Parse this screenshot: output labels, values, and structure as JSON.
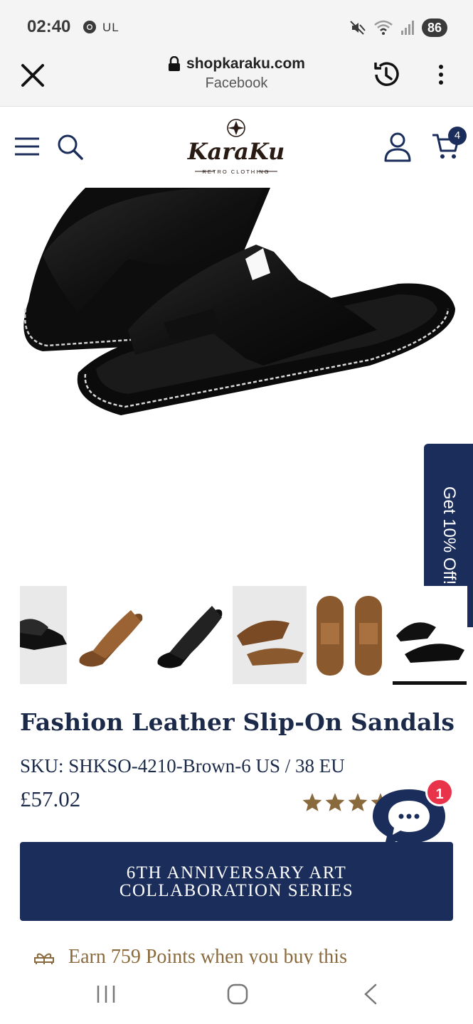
{
  "status_bar": {
    "time": "02:40",
    "carrier": "UL",
    "battery": "86"
  },
  "browser": {
    "url": "shopkaraku.com",
    "subtitle": "Facebook"
  },
  "header": {
    "logo_text": "KaraKu",
    "logo_tagline": "RETRO CLOTHING",
    "cart_count": "4"
  },
  "promo_tab": {
    "label": "Get 10% Off!"
  },
  "product": {
    "title": "Fashion Leather Slip-On Sandals",
    "sku": "SKU: SHKSO-4210-Brown-6 US / 38 EU",
    "price": "£57.02",
    "rating_stars": 4.5,
    "rating_count_suffix": ")"
  },
  "chat": {
    "badge": "1"
  },
  "banner": {
    "line1": "6TH ANNIVERSARY ART",
    "line2": "COLLABORATION SERIES"
  },
  "points": {
    "text": "Earn 759 Points when you buy this"
  },
  "colors": {
    "navy": "#1b2d5a",
    "gold": "#8a6a3c",
    "badge_red": "#e8334a"
  }
}
